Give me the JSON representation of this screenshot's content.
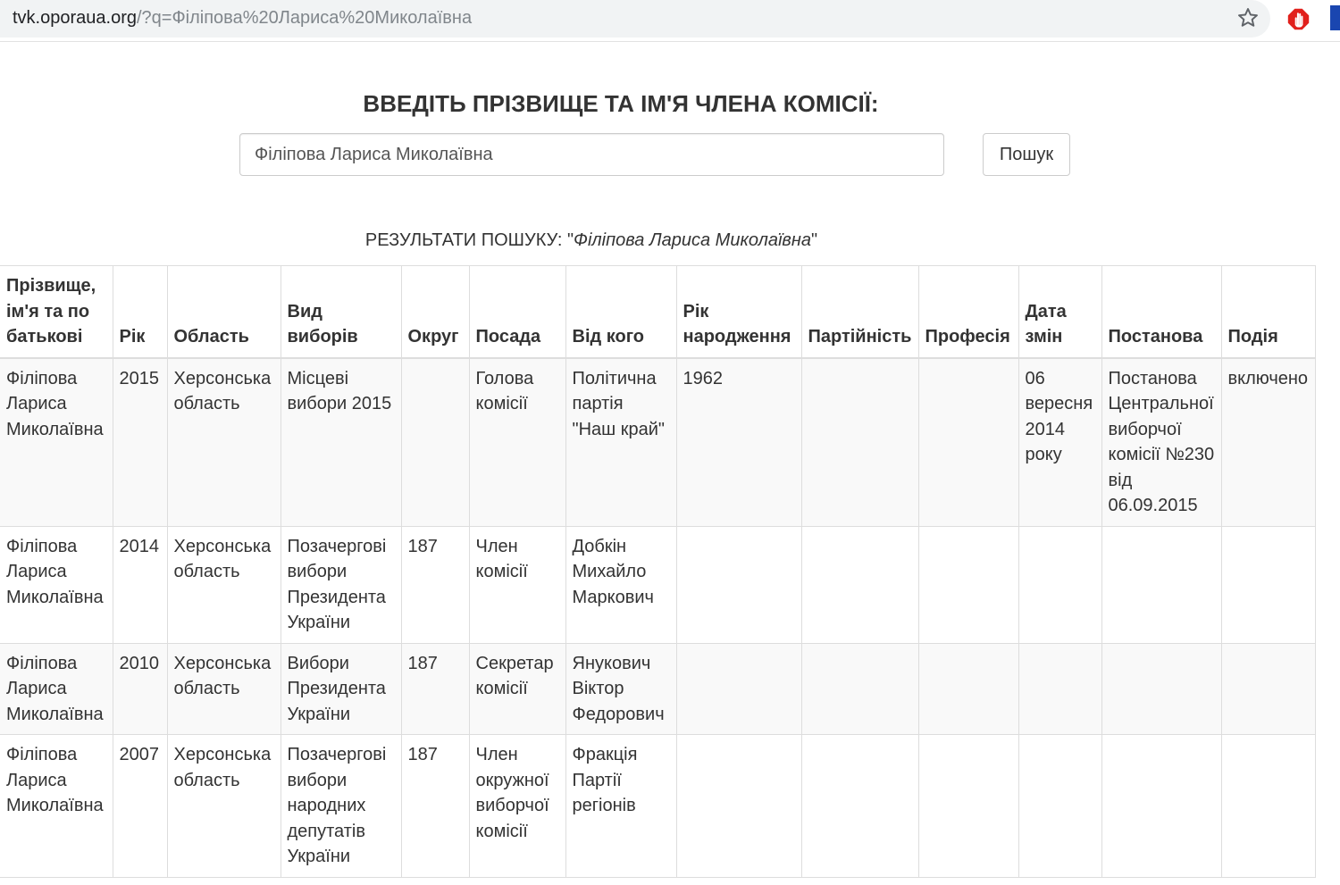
{
  "browser": {
    "url_host": "tvk.oporaua.org",
    "url_rest": "/?q=Філіпова%20Лариса%20Миколаївна"
  },
  "search": {
    "heading": "ВВЕДІТЬ ПРІЗВИЩЕ ТА ІМ'Я ЧЛЕНА КОМІСІЇ:",
    "value": "Філіпова Лариса Миколаївна",
    "button_label": "Пошук"
  },
  "results": {
    "caption_prefix": "РЕЗУЛЬТАТИ ПОШУКУ: \"",
    "caption_query": "Філіпова Лариса Миколаївна",
    "caption_suffix": "\"",
    "columns": [
      "Прізвище, ім'я та по батькові",
      "Рік",
      "Область",
      "Вид виборів",
      "Округ",
      "Посада",
      "Від кого",
      "Рік народження",
      "Партійність",
      "Професія",
      "Дата змін",
      "Постанова",
      "Подія"
    ],
    "rows": [
      [
        "Філіпова Лариса Миколаївна",
        "2015",
        "Херсонська область",
        "Місцеві вибори 2015",
        "",
        "Голова комісії",
        "Політична партія \"Наш край\"",
        "1962",
        "",
        "",
        "06 вересня 2014 року",
        "Постанова Центральної виборчої комісії №230 від 06.09.2015",
        "включено"
      ],
      [
        "Філіпова Лариса Миколаївна",
        "2014",
        "Херсонська область",
        "Позачергові вибори Президента України",
        "187",
        "Член комісії",
        "Добкін Михайло Маркович",
        "",
        "",
        "",
        "",
        "",
        ""
      ],
      [
        "Філіпова Лариса Миколаївна",
        "2010",
        "Херсонська область",
        "Вибори Президента України",
        "187",
        "Секретар комісії",
        "Янукович Віктор Федорович",
        "",
        "",
        "",
        "",
        "",
        ""
      ],
      [
        "Філіпова Лариса Миколаївна",
        "2007",
        "Херсонська область",
        "Позачергові вибори народних депутатів України",
        "187",
        "Член окружної виборчої комісії",
        "Фракція Партії регіонів",
        "",
        "",
        "",
        "",
        "",
        ""
      ]
    ]
  }
}
